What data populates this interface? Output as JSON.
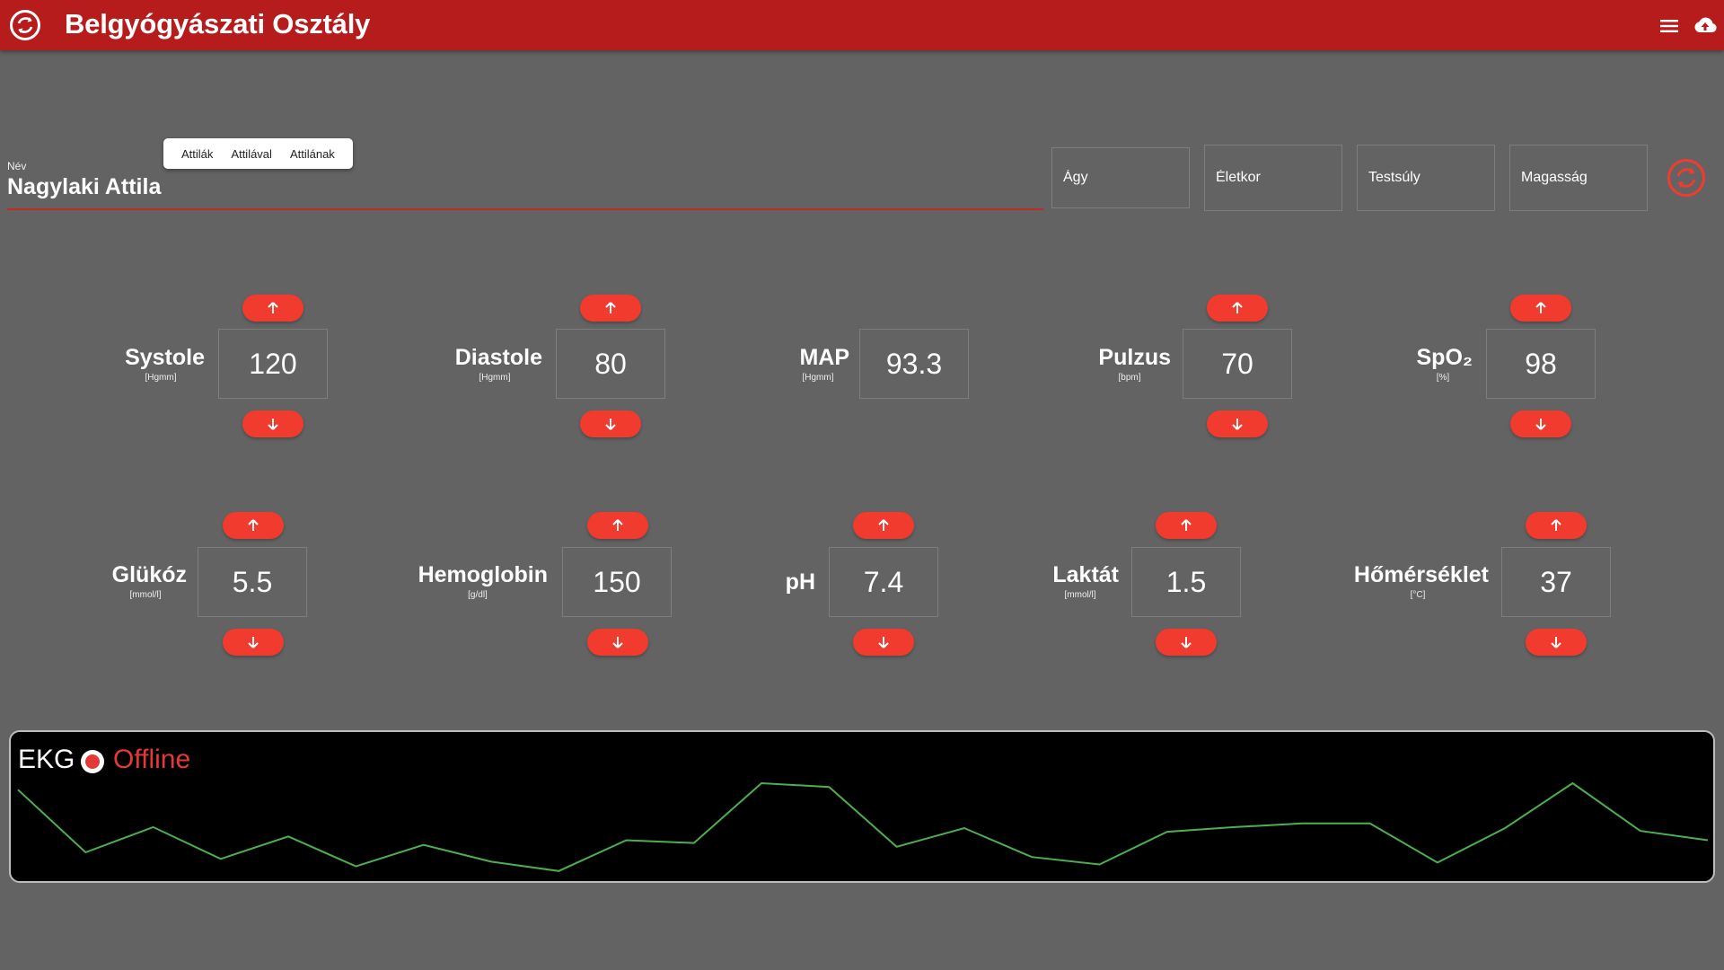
{
  "app": {
    "title": "Belgyógyászati Osztály",
    "accent_color": "#b71c1c",
    "button_color": "#f23b2f",
    "icons": [
      "sync-icon",
      "menu-icon",
      "cloud-upload-icon"
    ]
  },
  "patient": {
    "name_label": "Név",
    "name_value": "Nagylaki Attila",
    "suggestions": [
      "Attilák",
      "Attilával",
      "Attilának"
    ],
    "fields": [
      {
        "id": "bed",
        "placeholder": "Ágy"
      },
      {
        "id": "age",
        "placeholder": "Életkor"
      },
      {
        "id": "weight",
        "placeholder": "Testsúly"
      },
      {
        "id": "height",
        "placeholder": "Magasság"
      }
    ]
  },
  "vitals_row1": [
    {
      "name": "Systole",
      "unit": "[Hgmm]",
      "value": "120",
      "adjustable": true
    },
    {
      "name": "Diastole",
      "unit": "[Hgmm]",
      "value": "80",
      "adjustable": true
    },
    {
      "name": "MAP",
      "unit": "[Hgmm]",
      "value": "93.3",
      "adjustable": false
    },
    {
      "name": "Pulzus",
      "unit": "[bpm]",
      "value": "70",
      "adjustable": true
    },
    {
      "name": "SpO₂",
      "unit": "[%]",
      "value": "98",
      "adjustable": true
    }
  ],
  "vitals_row2": [
    {
      "name": "Glükóz",
      "unit": "[mmol/l]",
      "value": "5.5",
      "adjustable": true
    },
    {
      "name": "Hemoglobin",
      "unit": "[g/dl]",
      "value": "150",
      "adjustable": true
    },
    {
      "name": "pH",
      "unit": "",
      "value": "7.4",
      "adjustable": true
    },
    {
      "name": "Laktát",
      "unit": "[mmol/l]",
      "value": "1.5",
      "adjustable": true
    },
    {
      "name": "Hőmérséklet",
      "unit": "[°C]",
      "value": "37",
      "adjustable": true
    }
  ],
  "ekg": {
    "title": "EKG",
    "status": "Offline",
    "status_color": "#e53935",
    "trace_color": "#4caf50",
    "samples": [
      0.92,
      0.25,
      0.52,
      0.18,
      0.42,
      0.1,
      0.33,
      0.15,
      0.05,
      0.38,
      0.35,
      0.99,
      0.95,
      0.31,
      0.51,
      0.2,
      0.12,
      0.47,
      0.52,
      0.56,
      0.56,
      0.14,
      0.51,
      0.99,
      0.48,
      0.38
    ]
  }
}
